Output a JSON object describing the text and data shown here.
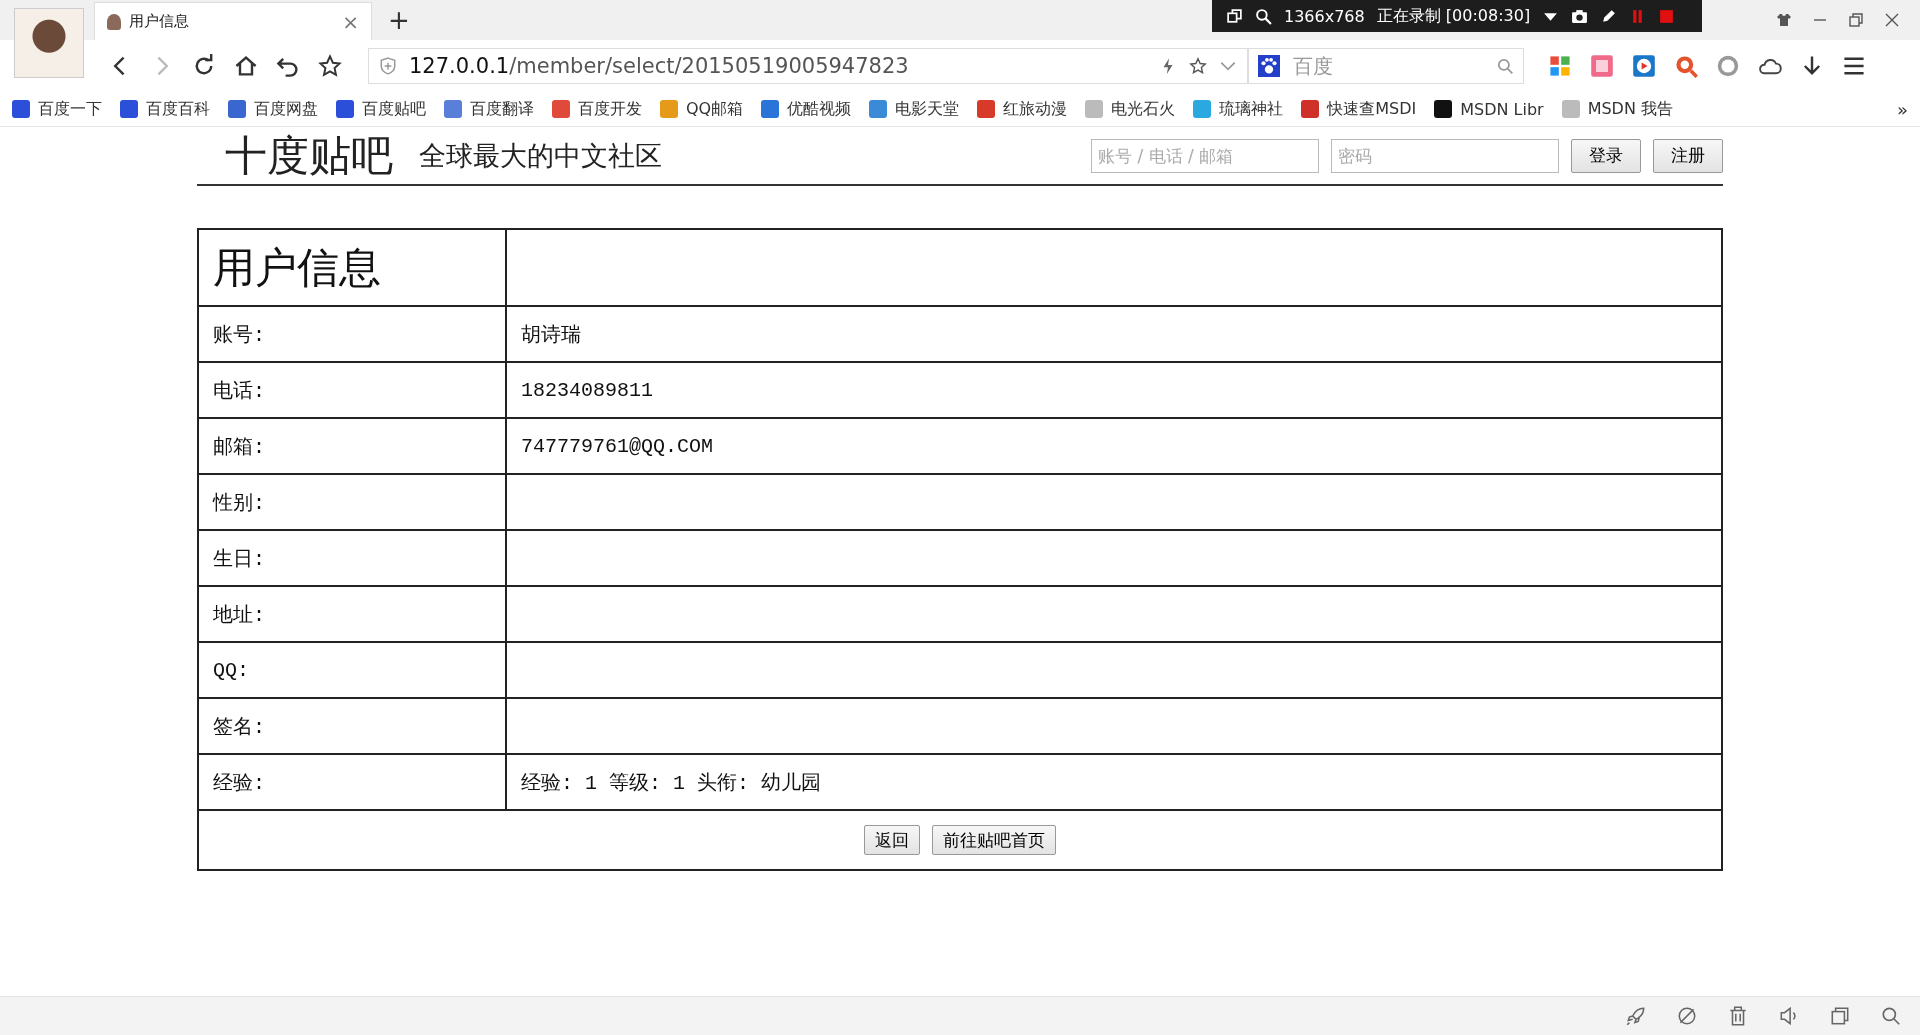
{
  "browser": {
    "tab": {
      "title": "用户信息",
      "close": "×"
    },
    "new_tab": "+",
    "recorder": {
      "resolution": "1366x768",
      "status": "正在录制 [00:08:30]"
    },
    "url": {
      "host": "127.0.0.1",
      "path": "/member/select/20150519005947823"
    },
    "search": {
      "placeholder": "百度"
    },
    "bookmarks": [
      {
        "label": "百度一下"
      },
      {
        "label": "百度百科"
      },
      {
        "label": "百度网盘"
      },
      {
        "label": "百度贴吧"
      },
      {
        "label": "百度翻译"
      },
      {
        "label": "百度开发"
      },
      {
        "label": "QQ邮箱"
      },
      {
        "label": "优酷视频"
      },
      {
        "label": "电影天堂"
      },
      {
        "label": "红旅动漫"
      },
      {
        "label": "电光石火"
      },
      {
        "label": "琉璃神社"
      },
      {
        "label": "快速查MSDI"
      },
      {
        "label": "MSDN Libr"
      },
      {
        "label": "MSDN 我告"
      }
    ],
    "more": "»"
  },
  "site": {
    "logo": "十度贴吧",
    "slogan": "全球最大的中文社区",
    "account_placeholder": "账号 / 电话 / 邮箱",
    "password_placeholder": "密码",
    "buttons": [
      "登录",
      "注册"
    ]
  },
  "profile": {
    "title": "用户信息",
    "rows": [
      {
        "label": "账号:",
        "value": "胡诗瑞"
      },
      {
        "label": "电话:",
        "value": "18234089811"
      },
      {
        "label": "邮箱:",
        "value": "747779761@QQ.COM"
      },
      {
        "label": "性别:",
        "value": ""
      },
      {
        "label": "生日:",
        "value": ""
      },
      {
        "label": "地址:",
        "value": ""
      },
      {
        "label": "QQ:",
        "value": ""
      },
      {
        "label": "签名:",
        "value": ""
      },
      {
        "label": "经验:",
        "value": "经验: 1  等级: 1  头衔: 幼儿园"
      }
    ],
    "buttons": [
      "返回",
      "前往贴吧首页"
    ]
  }
}
